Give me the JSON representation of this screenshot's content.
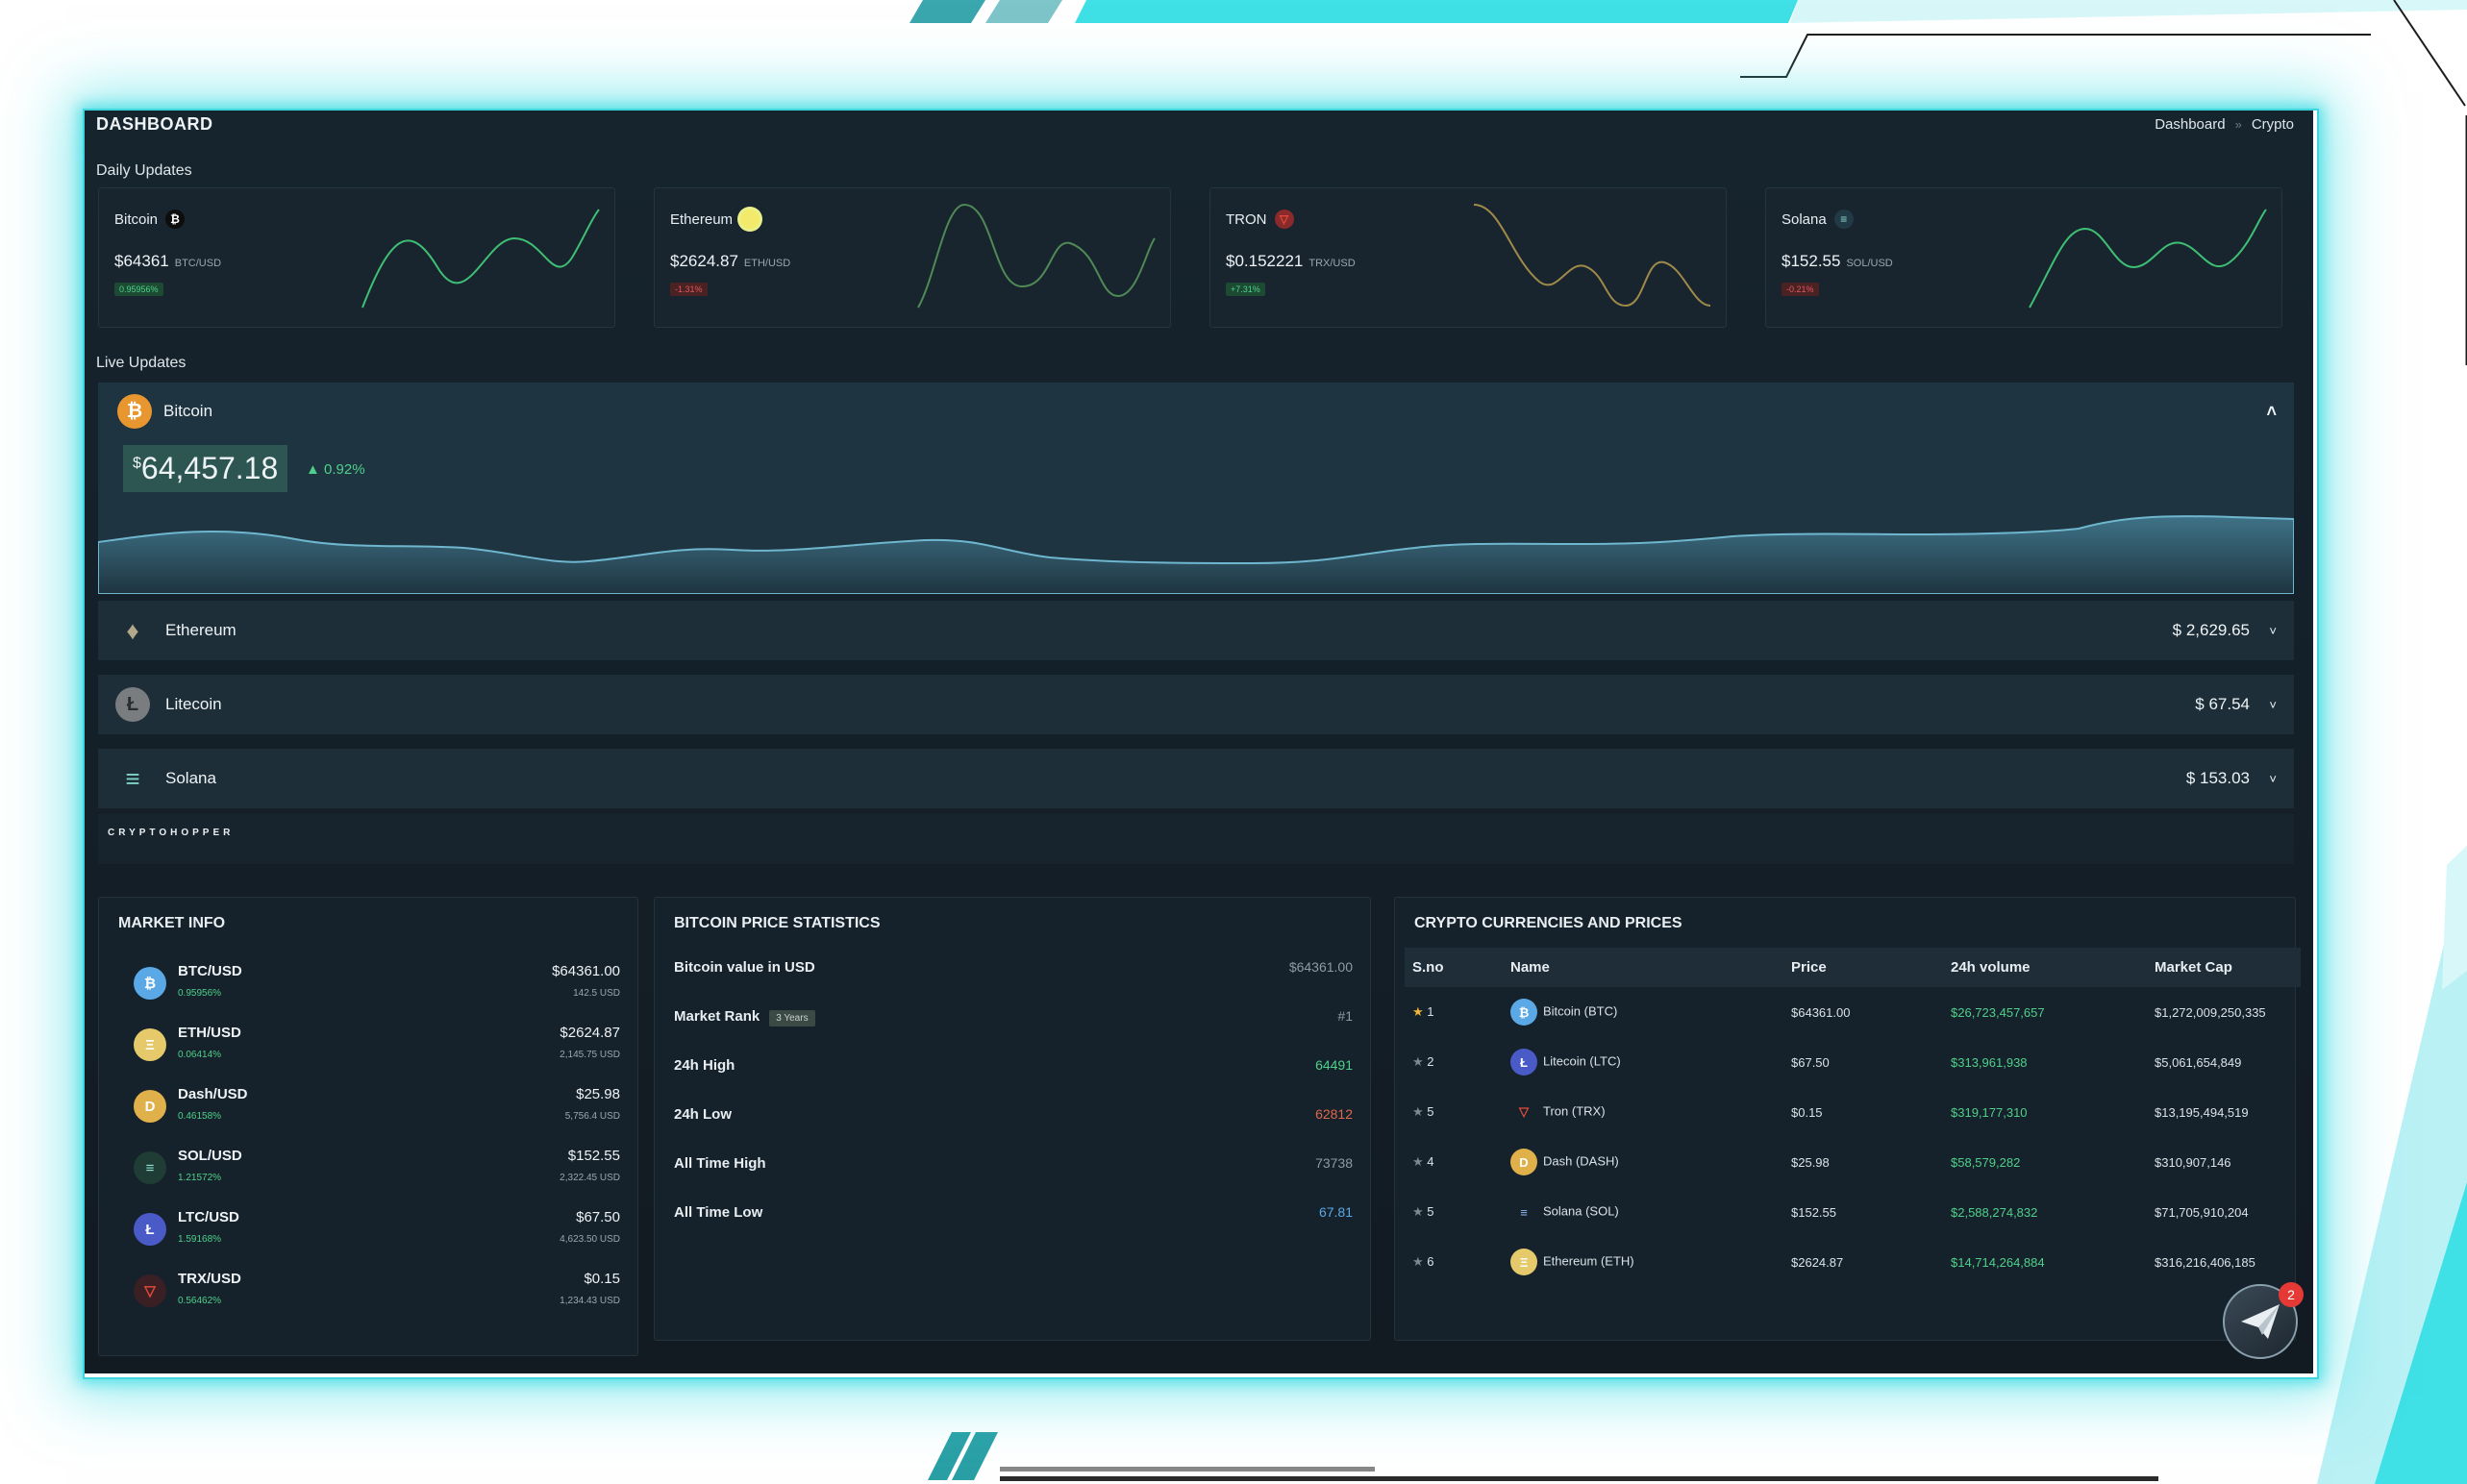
{
  "header": {
    "title": "DASHBOARD",
    "breadcrumb": [
      "Dashboard",
      "»",
      "Crypto"
    ]
  },
  "daily": {
    "label": "Daily Updates",
    "cards": [
      {
        "name": "Bitcoin",
        "icon": "bitcoin-icon",
        "price": "$64361",
        "pair": "BTC/USD",
        "change": "0.95956%",
        "trend": "up"
      },
      {
        "name": "Ethereum",
        "icon": "ethereum-icon",
        "price": "$2624.87",
        "pair": "ETH/USD",
        "change": "-1.31%",
        "trend": "down"
      },
      {
        "name": "TRON",
        "icon": "tron-icon",
        "price": "$0.152221",
        "pair": "TRX/USD",
        "change": "+7.31%",
        "trend": "up"
      },
      {
        "name": "Solana",
        "icon": "solana-icon",
        "price": "$152.55",
        "pair": "SOL/USD",
        "change": "-0.21%",
        "trend": "down"
      }
    ]
  },
  "live": {
    "label": "Live Updates",
    "main": {
      "name": "Bitcoin",
      "currency": "$",
      "price": "64,457.18",
      "change": "0.92%",
      "chevron": "˄"
    },
    "rows": [
      {
        "name": "Ethereum",
        "value": "$ 2,629.65",
        "chevron": "˅"
      },
      {
        "name": "Litecoin",
        "value": "$ 67.54",
        "chevron": "˅"
      },
      {
        "name": "Solana",
        "value": "$ 153.03",
        "chevron": "˅"
      }
    ],
    "widget_brand": "CRYPTOHOPPER"
  },
  "market_info": {
    "title": "MARKET INFO",
    "items": [
      {
        "pair": "BTC/USD",
        "pct": "0.95956%",
        "price": "$64361.00",
        "vol": "142.5 USD",
        "icon": "bitcoin-icon",
        "glyph": "₿"
      },
      {
        "pair": "ETH/USD",
        "pct": "0.06414%",
        "price": "$2624.87",
        "vol": "2,145.75 USD",
        "icon": "ethereum-icon",
        "glyph": "Ξ"
      },
      {
        "pair": "Dash/USD",
        "pct": "0.46158%",
        "price": "$25.98",
        "vol": "5,756.4 USD",
        "icon": "dash-icon",
        "glyph": "D"
      },
      {
        "pair": "SOL/USD",
        "pct": "1.21572%",
        "price": "$152.55",
        "vol": "2,322.45 USD",
        "icon": "solana-icon",
        "glyph": "≡"
      },
      {
        "pair": "LTC/USD",
        "pct": "1.59168%",
        "price": "$67.50",
        "vol": "4,623.50 USD",
        "icon": "litecoin-icon",
        "glyph": "Ł"
      },
      {
        "pair": "TRX/USD",
        "pct": "0.56462%",
        "price": "$0.15",
        "vol": "1,234.43 USD",
        "icon": "tron-icon",
        "glyph": "▽"
      }
    ]
  },
  "btc_stats": {
    "title": "BITCOIN PRICE STATISTICS",
    "rows": [
      {
        "label": "Bitcoin value in USD",
        "value": "$64361.00",
        "tone": "muted"
      },
      {
        "label": "Market Rank",
        "badge": "3 Years",
        "value": "#1",
        "tone": "muted"
      },
      {
        "label": "24h High",
        "value": "64491",
        "tone": "green"
      },
      {
        "label": "24h Low",
        "value": "62812",
        "tone": "red"
      },
      {
        "label": "All Time High",
        "value": "73738",
        "tone": "muted"
      },
      {
        "label": "All Time Low",
        "value": "67.81",
        "tone": "blue"
      }
    ]
  },
  "crypto_table": {
    "title": "CRYPTO CURRENCIES AND PRICES",
    "columns": [
      "S.no",
      "Name",
      "Price",
      "24h volume",
      "Market Cap"
    ],
    "rows": [
      {
        "sno": "1",
        "star": "gold",
        "name": "Bitcoin (BTC)",
        "price": "$64361.00",
        "volume": "$26,723,457,657",
        "cap": "$1,272,009,250,335"
      },
      {
        "sno": "2",
        "star": "gray",
        "name": "Litecoin (LTC)",
        "price": "$67.50",
        "volume": "$313,961,938",
        "cap": "$5,061,654,849"
      },
      {
        "sno": "5",
        "star": "gray",
        "name": "Tron (TRX)",
        "price": "$0.15",
        "volume": "$319,177,310",
        "cap": "$13,195,494,519"
      },
      {
        "sno": "4",
        "star": "gray",
        "name": "Dash (DASH)",
        "price": "$25.98",
        "volume": "$58,579,282",
        "cap": "$310,907,146"
      },
      {
        "sno": "5",
        "star": "gray",
        "name": "Solana (SOL)",
        "price": "$152.55",
        "volume": "$2,588,274,832",
        "cap": "$71,705,910,204"
      },
      {
        "sno": "6",
        "star": "gray",
        "name": "Ethereum (ETH)",
        "price": "$2624.87",
        "volume": "$14,714,264,884",
        "cap": "$316,216,406,185"
      }
    ]
  },
  "fab": {
    "badge": "2",
    "icon": "paper-plane-icon"
  },
  "colors": {
    "accent": "#3fd6de",
    "up": "#4fd08a",
    "down": "#e2575c",
    "bitcoin": "#e8962f"
  }
}
